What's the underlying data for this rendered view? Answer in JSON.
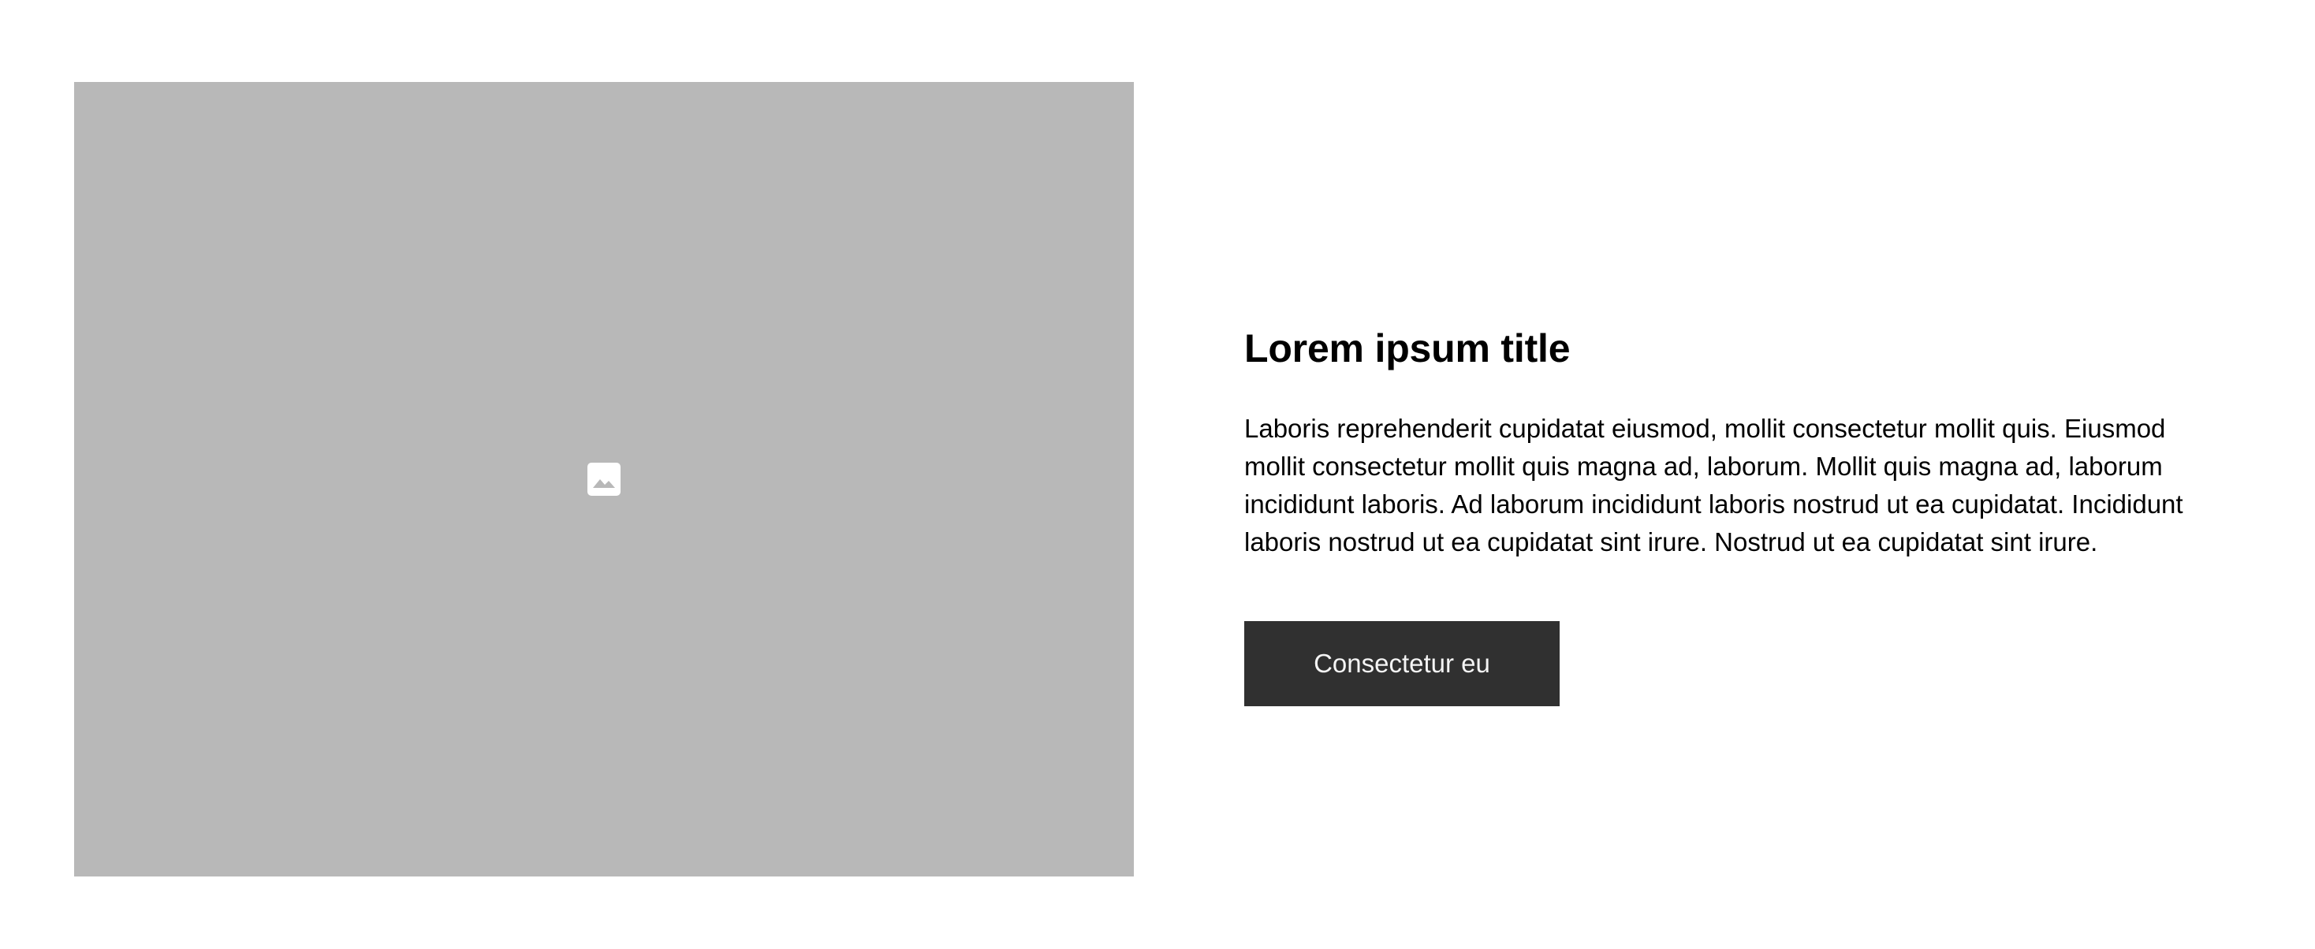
{
  "colors": {
    "image_placeholder": "#b8b8b8",
    "button_background": "#303030",
    "button_text": "#f4f4f4",
    "text": "#000000"
  },
  "media": {
    "icon": "image-icon"
  },
  "content": {
    "title": "Lorem ipsum title",
    "body": "Laboris reprehenderit cupidatat eiusmod, mollit consectetur mollit quis. Eiusmod mollit consectetur mollit quis magna ad, laborum. Mollit quis magna ad, laborum incididunt laboris. Ad laborum incididunt laboris nostrud ut ea cupidatat. Incididunt laboris nostrud ut ea cupidatat sint irure. Nostrud ut ea cupidatat sint irure.",
    "button_label": "Consectetur eu"
  }
}
